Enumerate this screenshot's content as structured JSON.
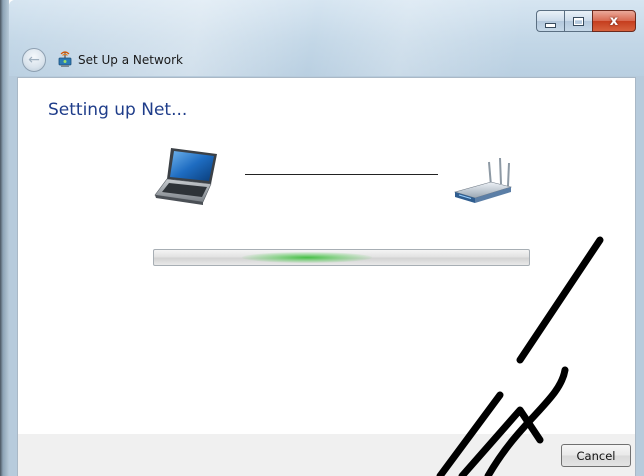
{
  "window": {
    "title": "Set Up a Network",
    "caption_buttons": {
      "minimize": "minimize",
      "maximize": "maximize",
      "close": "x"
    }
  },
  "icons": {
    "back": "back-arrow-icon",
    "title": "network-setup-icon",
    "laptop": "laptop-icon",
    "router": "wireless-router-icon"
  },
  "content": {
    "heading": "Setting up Net...",
    "progress": {
      "state": "indeterminate",
      "color": "#3ebe3e"
    }
  },
  "footer": {
    "cancel_label": "Cancel"
  },
  "colors": {
    "heading": "#1f3d8a",
    "titlebar": "#c3d7e7",
    "close_button": "#c53d1e"
  }
}
